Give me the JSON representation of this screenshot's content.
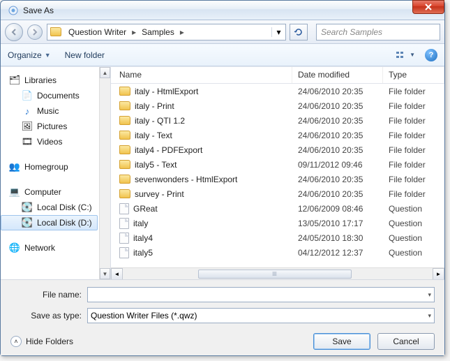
{
  "window": {
    "title": "Save As"
  },
  "nav": {
    "crumbs": [
      "Question Writer",
      "Samples"
    ],
    "search_placeholder": "Search Samples"
  },
  "toolbar": {
    "organize": "Organize",
    "new_folder": "New folder"
  },
  "sidebar": {
    "libraries": {
      "label": "Libraries",
      "items": [
        "Documents",
        "Music",
        "Pictures",
        "Videos"
      ]
    },
    "homegroup": {
      "label": "Homegroup"
    },
    "computer": {
      "label": "Computer",
      "items": [
        "Local Disk (C:)",
        "Local Disk (D:)"
      ],
      "selected_index": 1
    },
    "network": {
      "label": "Network"
    }
  },
  "columns": {
    "name": "Name",
    "date": "Date modified",
    "type": "Type"
  },
  "files": [
    {
      "icon": "folder",
      "name": "italy - HtmlExport",
      "date": "24/06/2010 20:35",
      "type": "File folder"
    },
    {
      "icon": "folder",
      "name": "italy - Print",
      "date": "24/06/2010 20:35",
      "type": "File folder"
    },
    {
      "icon": "folder",
      "name": "italy - QTI 1.2",
      "date": "24/06/2010 20:35",
      "type": "File folder"
    },
    {
      "icon": "folder",
      "name": "italy - Text",
      "date": "24/06/2010 20:35",
      "type": "File folder"
    },
    {
      "icon": "folder",
      "name": "italy4 - PDFExport",
      "date": "24/06/2010 20:35",
      "type": "File folder"
    },
    {
      "icon": "folder",
      "name": "italy5 - Text",
      "date": "09/11/2012 09:46",
      "type": "File folder"
    },
    {
      "icon": "folder",
      "name": "sevenwonders - HtmlExport",
      "date": "24/06/2010 20:35",
      "type": "File folder"
    },
    {
      "icon": "folder",
      "name": "survey - Print",
      "date": "24/06/2010 20:35",
      "type": "File folder"
    },
    {
      "icon": "file",
      "name": "GReat",
      "date": "12/06/2009 08:46",
      "type": "Question"
    },
    {
      "icon": "file",
      "name": "italy",
      "date": "13/05/2010 17:17",
      "type": "Question"
    },
    {
      "icon": "file",
      "name": "italy4",
      "date": "24/05/2010 18:30",
      "type": "Question"
    },
    {
      "icon": "file",
      "name": "italy5",
      "date": "04/12/2012 12:37",
      "type": "Question"
    }
  ],
  "form": {
    "filename_label": "File name:",
    "filename_value": "",
    "type_label": "Save as type:",
    "type_value": "Question Writer Files (*.qwz)"
  },
  "actions": {
    "hide_folders": "Hide Folders",
    "save": "Save",
    "cancel": "Cancel"
  }
}
